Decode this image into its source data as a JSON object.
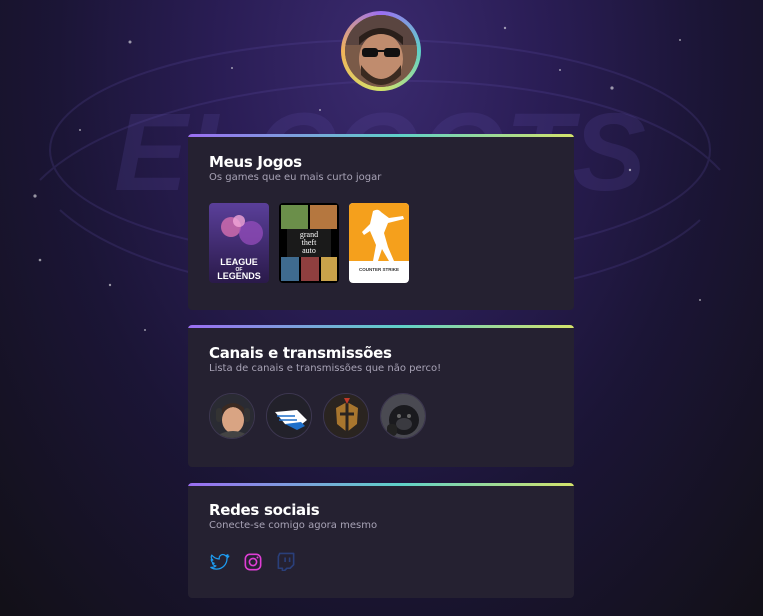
{
  "background": {
    "watermark": "ELCOOTS"
  },
  "profile": {
    "avatar": "avatar"
  },
  "games_card": {
    "title": "Meus Jogos",
    "subtitle": "Os games que eu mais curto jogar",
    "games": [
      {
        "name": "League of Legends",
        "logo_line1": "LEAGUE",
        "logo_line2": "OF",
        "logo_line3": "LEGENDS"
      },
      {
        "name": "Grand Theft Auto V",
        "logo_line1": "grand",
        "logo_line2": "theft",
        "logo_line3": "auto"
      },
      {
        "name": "Counter-Strike",
        "logo_text": "COUNTER STRIKE"
      }
    ]
  },
  "channels_card": {
    "title": "Canais e transmissões",
    "subtitle": "Lista de canais e transmissões que não perco!",
    "channels": [
      {
        "icon": "streamer-avatar"
      },
      {
        "icon": "wings-logo"
      },
      {
        "icon": "gladiator-helmet-logo"
      },
      {
        "icon": "gorilla-avatar"
      }
    ]
  },
  "social_card": {
    "title": "Redes sociais",
    "subtitle": "Conecte-se comigo agora mesmo",
    "links": [
      {
        "icon": "twitter-icon",
        "color": "#1d9bf0"
      },
      {
        "icon": "instagram-icon",
        "color": "#e03ed6"
      },
      {
        "icon": "twitch-icon",
        "color": "#2a3f7a"
      }
    ]
  },
  "colors": {
    "card_bg": "#252131",
    "accent_gradient": [
      "#9b6ef3",
      "#5fd1c8",
      "#d4e36b"
    ]
  }
}
